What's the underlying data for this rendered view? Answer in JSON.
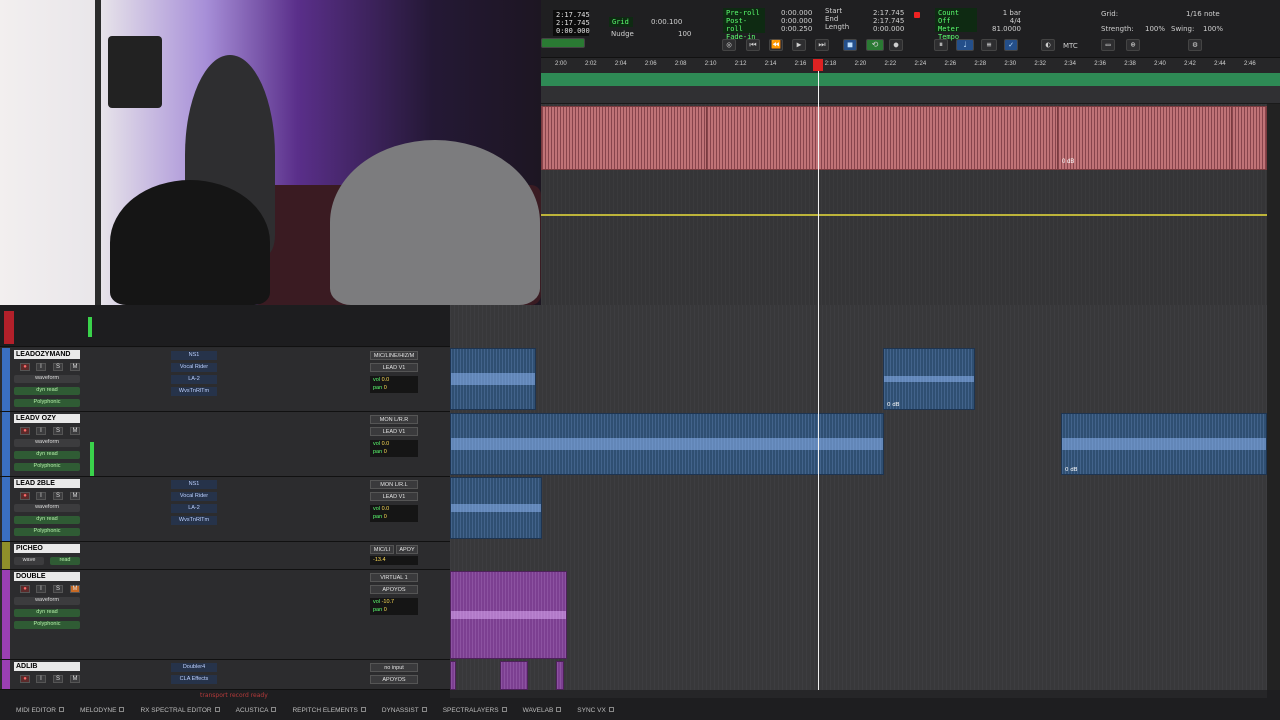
{
  "transport": {
    "counter_main": "2:17.745",
    "counter_sub1": "2:17.745",
    "counter_sub2": "0:00.000",
    "grid_label": "Grid",
    "grid_value": "0:00.100",
    "nudge_label": "Nudge",
    "nudge_value": "100",
    "preroll": "Pre-roll",
    "postroll": "Post-roll",
    "fadein": "Fade-in",
    "preroll_val": "0:00.000",
    "postroll_val": "0:00.000",
    "fadein_val": "0:00.250",
    "start_label": "Start",
    "end_label": "End",
    "length_label": "Length",
    "start_val": "2:17.745",
    "end_val": "2:17.745",
    "length_val": "0:00.000",
    "countoff_label": "Count Off",
    "countoff_val": "1 bar",
    "meter_label": "Meter",
    "meter_val": "4/4",
    "tempo_label": "Tempo",
    "tempo_val": "81.0000",
    "grid2_label": "Grid:",
    "grid2_val": "1/16 note",
    "strength_label": "Strength:",
    "strength_val": "100%",
    "swing_label": "Swing:",
    "swing_val": "100%",
    "mtc": "MTC"
  },
  "ruler": {
    "ticks": [
      "2:00",
      "2:02",
      "2:04",
      "2:06",
      "2:08",
      "2:10",
      "2:12",
      "2:14",
      "2:16",
      "2:18",
      "2:20",
      "2:22",
      "2:24",
      "2:26",
      "2:28",
      "2:30",
      "2:32",
      "2:34",
      "2:36",
      "2:38",
      "2:40",
      "2:42",
      "2:44",
      "2:46"
    ]
  },
  "upper_clip": {
    "gain_label": "0 dB"
  },
  "tracks": [
    {
      "name": "LEADOZYMAND",
      "inserts": [
        "NS1",
        "Vocal Rider",
        "LA-2",
        "WvsTnRlTm"
      ],
      "io_in": "MIC/LINE/HIZ/M",
      "io_out": "LEAD V1",
      "vol": "0.0",
      "pan": "0",
      "mode1": "waveform",
      "mode2": "dyn",
      "mode3": "read",
      "poly": "Polyphonic",
      "color": "#3a6fc2",
      "clip_gain": "0 dB"
    },
    {
      "name": "LEADV OZY",
      "inserts": [],
      "io_in": "MON L/R.R",
      "io_out": "LEAD V1",
      "vol": "0.0",
      "pan": "0",
      "mode1": "waveform",
      "mode2": "dyn",
      "mode3": "read",
      "poly": "Polyphonic",
      "color": "#3a6fc2",
      "clip_gain": "0 dB"
    },
    {
      "name": "LEAD 2BLE",
      "inserts": [
        "NS1",
        "Vocal Rider",
        "LA-2",
        "WvsTnRlTm"
      ],
      "io_in": "MON L/R.L",
      "io_out": "LEAD V1",
      "vol": "0.0",
      "pan": "0",
      "mode1": "waveform",
      "mode2": "dyn",
      "mode3": "read",
      "poly": "Polyphonic",
      "color": "#3a6fc2"
    },
    {
      "name": "PICHEO",
      "io_in": "MIC/LI",
      "io_out": "APOY",
      "vol": "-13.4",
      "mode1": "wave",
      "mode3": "read",
      "color": "#8f8f2a"
    },
    {
      "name": "DOUBLE",
      "inserts": [],
      "io_in": "VIRTUAL 1",
      "io_out": "APOYOS",
      "vol": "-10.7",
      "pan": "0",
      "mode1": "waveform",
      "mode2": "dyn",
      "mode3": "read",
      "poly": "Polyphonic",
      "color": "#9a3fb3"
    },
    {
      "name": "ADLIB",
      "inserts": [
        "Doubler4",
        "CLA Effects"
      ],
      "io_in": "no input",
      "io_out": "APOYOS",
      "color": "#9a3fb3"
    }
  ],
  "status": "transport record ready",
  "bottom_tabs": [
    "MIDI EDITOR",
    "MELODYNE",
    "RX SPECTRAL EDITOR",
    "ACUSTICA",
    "REPITCH ELEMENTS",
    "DYNASSIST",
    "SPECTRALAYERS",
    "WAVELAB",
    "SYNC VX"
  ],
  "colors": {
    "upper_clip": "#c07377",
    "audio_clip": "#2f4f72",
    "purple_clip": "#7c3f91",
    "marker_bar": "#2e8a55"
  }
}
